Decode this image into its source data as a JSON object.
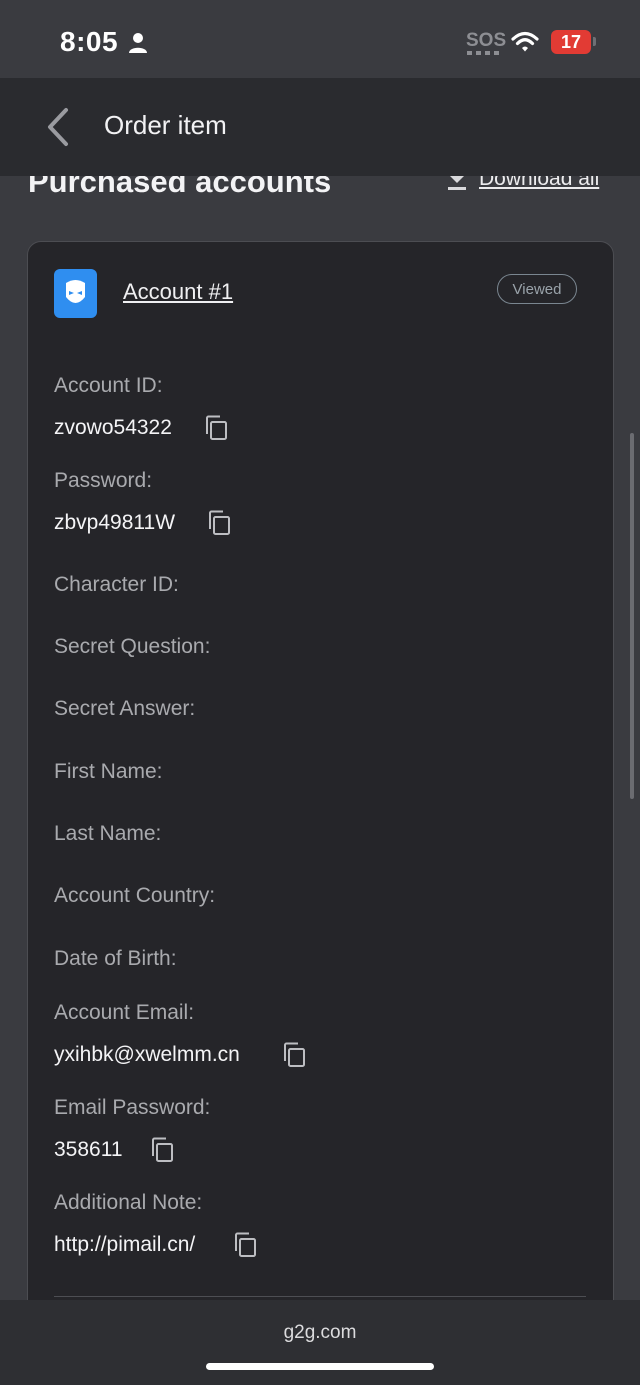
{
  "status": {
    "time": "8:05",
    "sos": "SOS",
    "battery": "17"
  },
  "header": {
    "title": "Order item"
  },
  "section": {
    "title": "Purchased accounts",
    "download_all": "Download all"
  },
  "account": {
    "name": "Account #1",
    "badge": "Viewed",
    "fields": [
      {
        "label": "Account ID:",
        "value": "zvowo54322"
      },
      {
        "label": "Password:",
        "value": "zbvp49811W"
      },
      {
        "label": "Character ID:",
        "value": ""
      },
      {
        "label": "Secret Question:",
        "value": ""
      },
      {
        "label": "Secret Answer:",
        "value": ""
      },
      {
        "label": "First Name:",
        "value": ""
      },
      {
        "label": "Last Name:",
        "value": ""
      },
      {
        "label": "Account Country:",
        "value": ""
      },
      {
        "label": "Date of Birth:",
        "value": ""
      },
      {
        "label": "Account Email:",
        "value": "yxihbk@xwelmm.cn"
      },
      {
        "label": "Email Password:",
        "value": "358611"
      },
      {
        "label": "Additional Note:",
        "value": "http://pimail.cn/"
      }
    ]
  },
  "browser": {
    "url": "g2g.com"
  },
  "colors": {
    "accent_blue": "#2f8ef0",
    "battery_red": "#e23b34"
  }
}
